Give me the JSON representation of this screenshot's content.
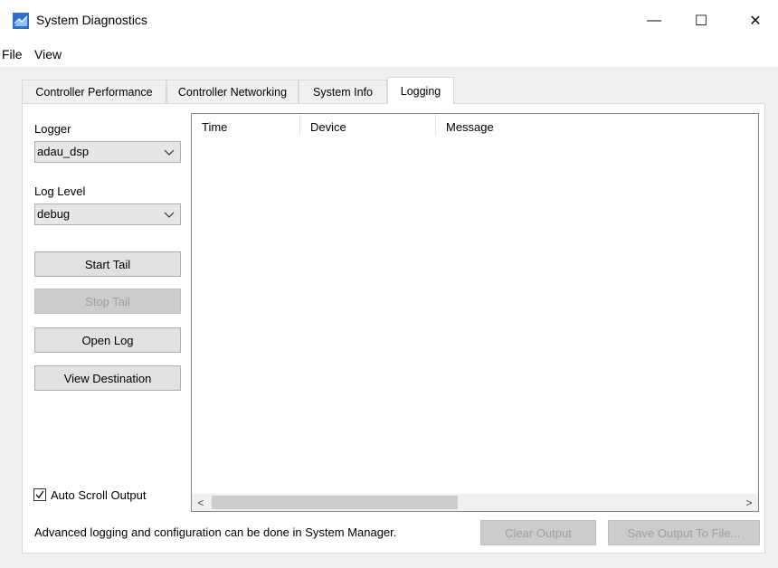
{
  "window": {
    "title": "System Diagnostics",
    "controls": {
      "minimize": "—",
      "maximize": "☐",
      "close": "✕"
    }
  },
  "menu": [
    "File",
    "View"
  ],
  "tabs": [
    {
      "label": "Controller Performance",
      "active": false
    },
    {
      "label": "Controller Networking",
      "active": false
    },
    {
      "label": "System Info",
      "active": false
    },
    {
      "label": "Logging",
      "active": true
    }
  ],
  "logging": {
    "logger_label": "Logger",
    "logger_value": "adau_dsp",
    "log_level_label": "Log Level",
    "log_level_value": "debug",
    "buttons": {
      "start_tail": "Start Tail",
      "stop_tail": "Stop Tail",
      "open_log": "Open Log",
      "view_destination": "View Destination"
    },
    "table": {
      "columns": [
        "Time",
        "Device",
        "Message"
      ],
      "rows": []
    },
    "auto_scroll_label": "Auto Scroll Output",
    "auto_scroll_checked": true,
    "footer_text": "Advanced logging and configuration can be done in System Manager.",
    "clear_output": "Clear Output",
    "save_output": "Save Output To File..."
  },
  "scrollbar": {
    "left_arrow": "<",
    "right_arrow": ">"
  },
  "icons": {
    "app": "system-diagnostics-icon",
    "dropdown": "chevron-down-icon",
    "check": "check-icon"
  },
  "colors": {
    "app_icon": "#3a7bd5",
    "disabled_text": "#a0a0a0"
  }
}
